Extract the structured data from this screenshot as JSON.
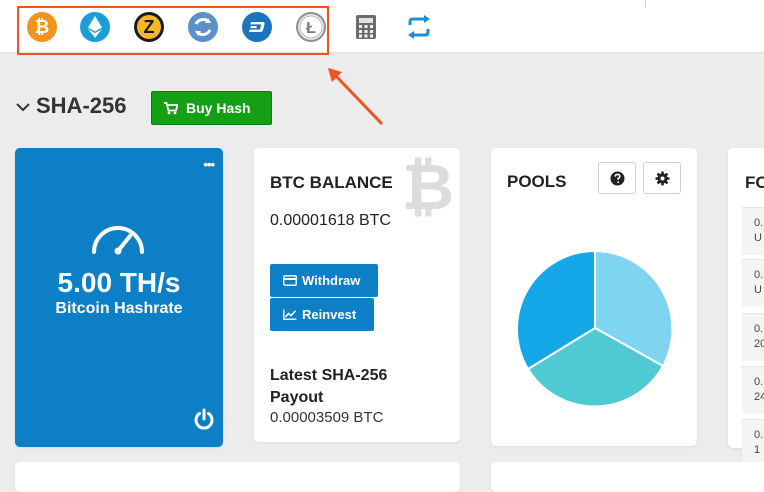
{
  "topbar": {
    "coins": [
      {
        "name": "bitcoin-icon",
        "color": "#f2931a"
      },
      {
        "name": "ethereum-icon",
        "color": "#1a9edb"
      },
      {
        "name": "zcash-icon",
        "color": "#f4b728"
      },
      {
        "name": "refresh-coin-icon",
        "color": "#5b90c8"
      },
      {
        "name": "dash-icon",
        "color": "#1c75bc"
      },
      {
        "name": "litecoin-icon",
        "color": "#a6a6a6"
      }
    ],
    "tools": [
      "calculator-icon",
      "exchange-arrows-icon"
    ]
  },
  "section": {
    "title": "SHA-256",
    "buy_label": "Buy Hash"
  },
  "hashrate_card": {
    "value": "5.00 TH/s",
    "label": "Bitcoin Hashrate",
    "menu": "•••"
  },
  "balance_card": {
    "title": "BTC BALANCE",
    "amount": "0.00001618 BTC",
    "withdraw_label": "Withdraw",
    "reinvest_label": "Reinvest",
    "payout_title": "Latest SHA-256 Payout",
    "payout_amount": "0.00003509 BTC"
  },
  "pools_card": {
    "title": "POOLS",
    "pie_colors": [
      "#7fd4f0",
      "#4fcad3",
      "#15a8e8"
    ]
  },
  "right_card": {
    "title": "FO",
    "rows": [
      {
        "line1": "0.",
        "line2": "U"
      },
      {
        "line1": "0.",
        "line2": "U"
      },
      {
        "line1": "0.",
        "line2": "20"
      },
      {
        "line1": "0.",
        "line2": "24"
      },
      {
        "line1": "0.",
        "line2": "1"
      }
    ]
  }
}
